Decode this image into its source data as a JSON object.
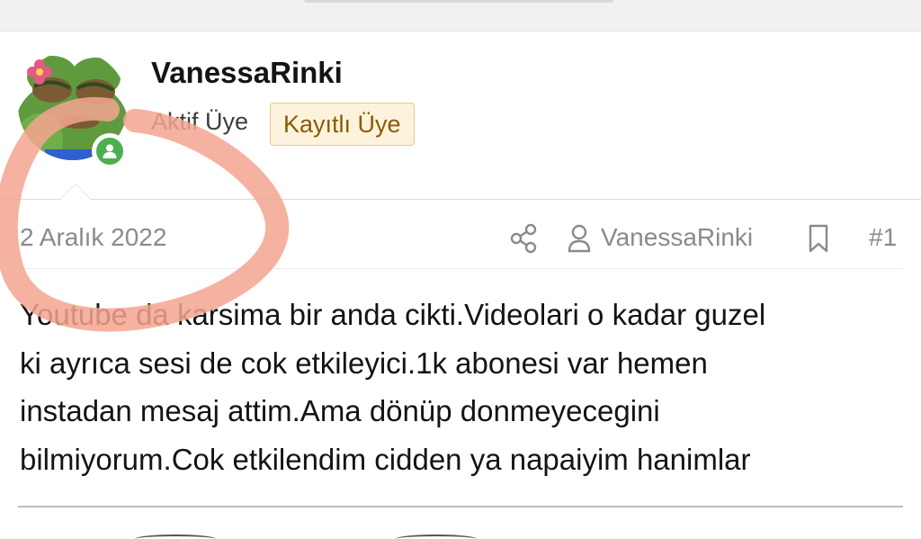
{
  "colors": {
    "accent_badge_bg": "#fdf3dc",
    "accent_badge_border": "#e8c77f",
    "accent_badge_text": "#8a5a08",
    "online_green": "#4caf50",
    "meta_gray": "#8a8a8a",
    "scribble_salmon": "#f4a590"
  },
  "post": {
    "author": {
      "username": "VanessaRinki",
      "role": "Aktif Üye",
      "badge": "Kayıtlı Üye",
      "avatar_icon": "frog-avatar-icon",
      "status_icon": "online-status-icon"
    },
    "meta": {
      "date": "2 Aralık 2022",
      "share_icon": "share-icon",
      "author_icon": "user-icon",
      "author_link": "VanessaRinki",
      "bookmark_icon": "bookmark-icon",
      "number": "#1"
    },
    "body": "Youtube da karsima bir anda cikti.Videolari o kadar guzel\nki ayrıca sesi de cok etkileyici.1k abonesi var hemen\ninstadan mesaj attim.Ama dönüp donmeyecegini\nbilmiyorum.Cok etkilendim cidden ya napaiyim hanimlar"
  }
}
